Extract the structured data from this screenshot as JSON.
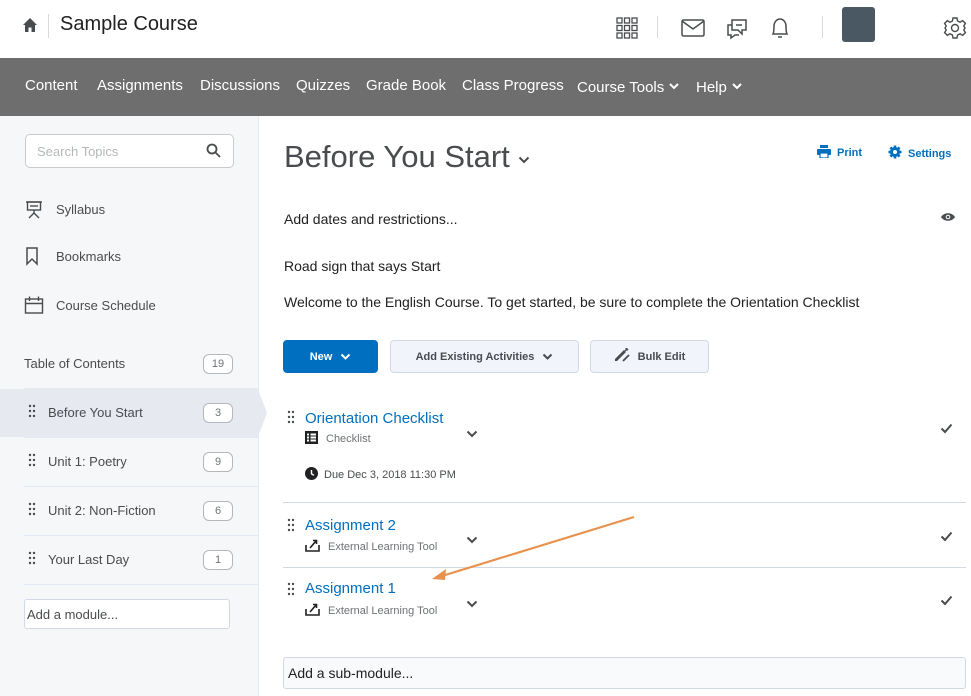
{
  "topbar": {
    "course_title": "Sample Course",
    "icons": [
      "home-icon",
      "waffle-icon",
      "mail-icon",
      "chat-icon",
      "bell-icon",
      "avatar",
      "gear-icon"
    ]
  },
  "nav": {
    "items": [
      {
        "label": "Content"
      },
      {
        "label": "Assignments"
      },
      {
        "label": "Discussions"
      },
      {
        "label": "Quizzes"
      },
      {
        "label": "Grade Book"
      },
      {
        "label": "Class Progress"
      },
      {
        "label": "Course Tools",
        "dropdown": true
      },
      {
        "label": "Help",
        "dropdown": true
      }
    ]
  },
  "sidebar": {
    "search_placeholder": "Search Topics",
    "links": [
      {
        "label": "Syllabus",
        "icon": "presentation-icon"
      },
      {
        "label": "Bookmarks",
        "icon": "bookmark-icon"
      },
      {
        "label": "Course Schedule",
        "icon": "calendar-icon"
      }
    ],
    "toc": {
      "label": "Table of Contents",
      "count": "19"
    },
    "modules": [
      {
        "label": "Before You Start",
        "count": "3",
        "active": true
      },
      {
        "label": "Unit 1: Poetry",
        "count": "9"
      },
      {
        "label": "Unit 2: Non-Fiction",
        "count": "6"
      },
      {
        "label": "Your Last Day",
        "count": "1"
      }
    ],
    "add_module": "Add a module..."
  },
  "main": {
    "title": "Before You Start",
    "print_label": "Print",
    "settings_label": "Settings",
    "add_dates": "Add dates and restrictions...",
    "image_alt": "Road sign that says Start",
    "welcome": "Welcome to the English Course. To get started, be sure to complete the Orientation Checklist",
    "buttons": {
      "new": "New",
      "add_existing": "Add Existing Activities",
      "bulk_edit": "Bulk Edit"
    },
    "topics": [
      {
        "title": "Orientation Checklist",
        "type": "Checklist",
        "due": "Due Dec 3, 2018 11:30 PM"
      },
      {
        "title": "Assignment 2",
        "type": "External Learning Tool"
      },
      {
        "title": "Assignment 1",
        "type": "External Learning Tool"
      }
    ],
    "add_submodule": "Add a sub-module..."
  },
  "colors": {
    "nav_bg": "#6e6e6e",
    "link_blue": "#006fbf",
    "primary_button": "#006fbf",
    "annotation_arrow": "#e8914d"
  }
}
